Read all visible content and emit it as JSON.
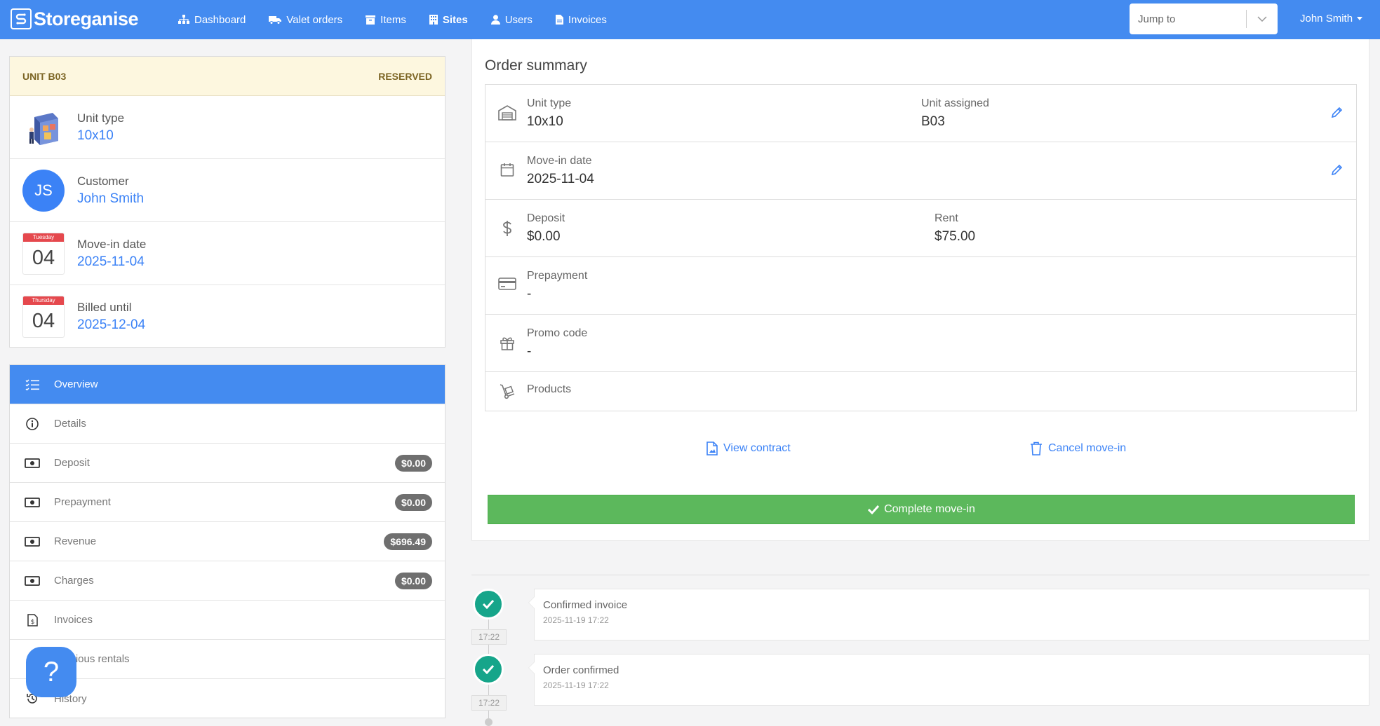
{
  "brand": {
    "name": "Storeganise"
  },
  "nav": {
    "items": [
      {
        "label": "Dashboard",
        "icon": "sitemap-icon"
      },
      {
        "label": "Valet orders",
        "icon": "truck-icon"
      },
      {
        "label": "Items",
        "icon": "archive-icon"
      },
      {
        "label": "Sites",
        "icon": "building-icon"
      },
      {
        "label": "Users",
        "icon": "user-icon"
      },
      {
        "label": "Invoices",
        "icon": "file-icon"
      }
    ],
    "active": "Sites",
    "jump_placeholder": "Jump to",
    "user_name": "John Smith"
  },
  "unit": {
    "title": "UNIT B03",
    "status": "RESERVED",
    "type_label": "Unit type",
    "type_value": "10x10",
    "customer_label": "Customer",
    "customer_initials": "JS",
    "customer_value": "John Smith",
    "movein_label": "Move-in date",
    "movein_weekday": "Tuesday",
    "movein_day": "04",
    "movein_value": "2025-11-04",
    "billed_label": "Billed until",
    "billed_weekday": "Thursday",
    "billed_day": "04",
    "billed_value": "2025-12-04"
  },
  "side_menu": {
    "overview": "Overview",
    "details": "Details",
    "deposit": "Deposit",
    "deposit_badge": "$0.00",
    "prepayment": "Prepayment",
    "prepayment_badge": "$0.00",
    "revenue": "Revenue",
    "revenue_badge": "$696.49",
    "charges": "Charges",
    "charges_badge": "$0.00",
    "invoices": "Invoices",
    "previous_rentals": "Previous rentals",
    "history": "History"
  },
  "help": {
    "label": "?"
  },
  "order": {
    "title": "Order summary",
    "unit_type_label": "Unit type",
    "unit_type_value": "10x10",
    "unit_assigned_label": "Unit assigned",
    "unit_assigned_value": "B03",
    "movein_label": "Move-in date",
    "movein_value": "2025-11-04",
    "deposit_label": "Deposit",
    "deposit_value": "$0.00",
    "rent_label": "Rent",
    "rent_value": "$75.00",
    "prepayment_label": "Prepayment",
    "prepayment_value": "-",
    "promo_label": "Promo code",
    "promo_value": "-",
    "products_label": "Products",
    "view_contract": "View contract",
    "cancel_movein": "Cancel move-in",
    "complete": "Complete move-in"
  },
  "timeline": [
    {
      "title": "Confirmed invoice",
      "datetime": "2025-11-19 17:22",
      "time": "17:22"
    },
    {
      "title": "Order confirmed",
      "datetime": "2025-11-19 17:22",
      "time": "17:22"
    }
  ],
  "colors": {
    "primary": "#448bf0",
    "link": "#3b82f6",
    "success": "#5cb85c",
    "timeline_dot": "#16a58a",
    "reserved_bg": "#fdf7df"
  }
}
